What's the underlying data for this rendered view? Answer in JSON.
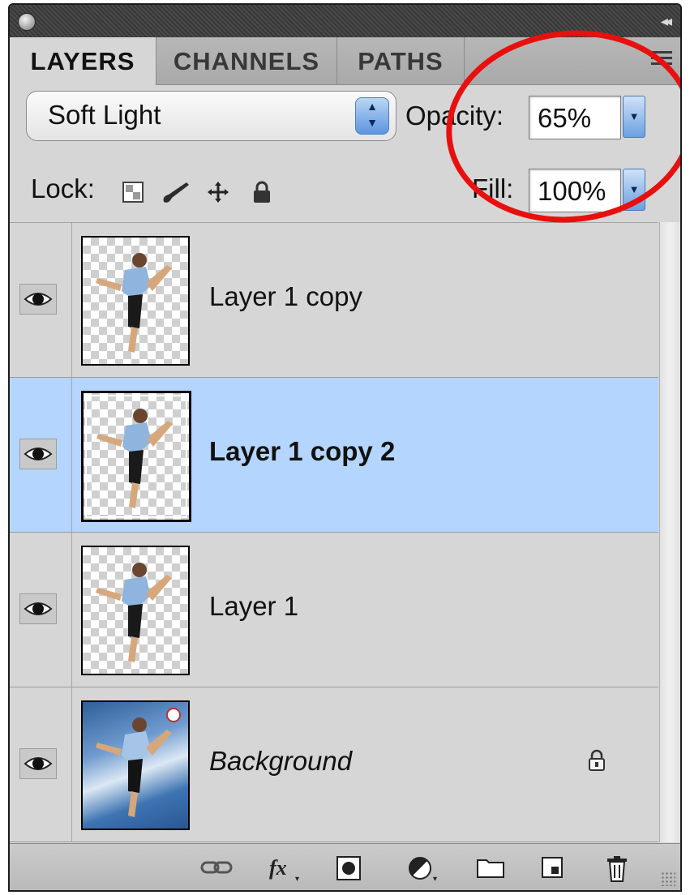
{
  "tabs": [
    {
      "label": "LAYERS"
    },
    {
      "label": "CHANNELS"
    },
    {
      "label": "PATHS"
    }
  ],
  "blend_mode": {
    "value": "Soft Light"
  },
  "opacity": {
    "label": "Opacity:",
    "value": "65%"
  },
  "fill": {
    "label": "Fill:",
    "value": "100%"
  },
  "lock": {
    "label": "Lock:",
    "icons": [
      "lock-transparent-pixels-icon",
      "lock-image-pixels-icon",
      "lock-position-icon",
      "lock-all-icon"
    ]
  },
  "layers": [
    {
      "name": "Layer 1 copy",
      "visible": true,
      "selected": false
    },
    {
      "name": "Layer 1 copy 2",
      "visible": true,
      "selected": true
    },
    {
      "name": "Layer 1",
      "visible": true,
      "selected": false
    },
    {
      "name": "Background",
      "visible": true,
      "selected": false,
      "locked": true
    }
  ],
  "footer_icons": [
    "link-layers-icon",
    "layer-style-fx-icon",
    "add-mask-icon",
    "adjustment-layer-icon",
    "new-group-icon",
    "new-layer-icon",
    "delete-layer-icon"
  ],
  "colors": {
    "selection": "#b4d5fd",
    "annotation": "#e8100f",
    "panel": "#d6d6d6"
  }
}
